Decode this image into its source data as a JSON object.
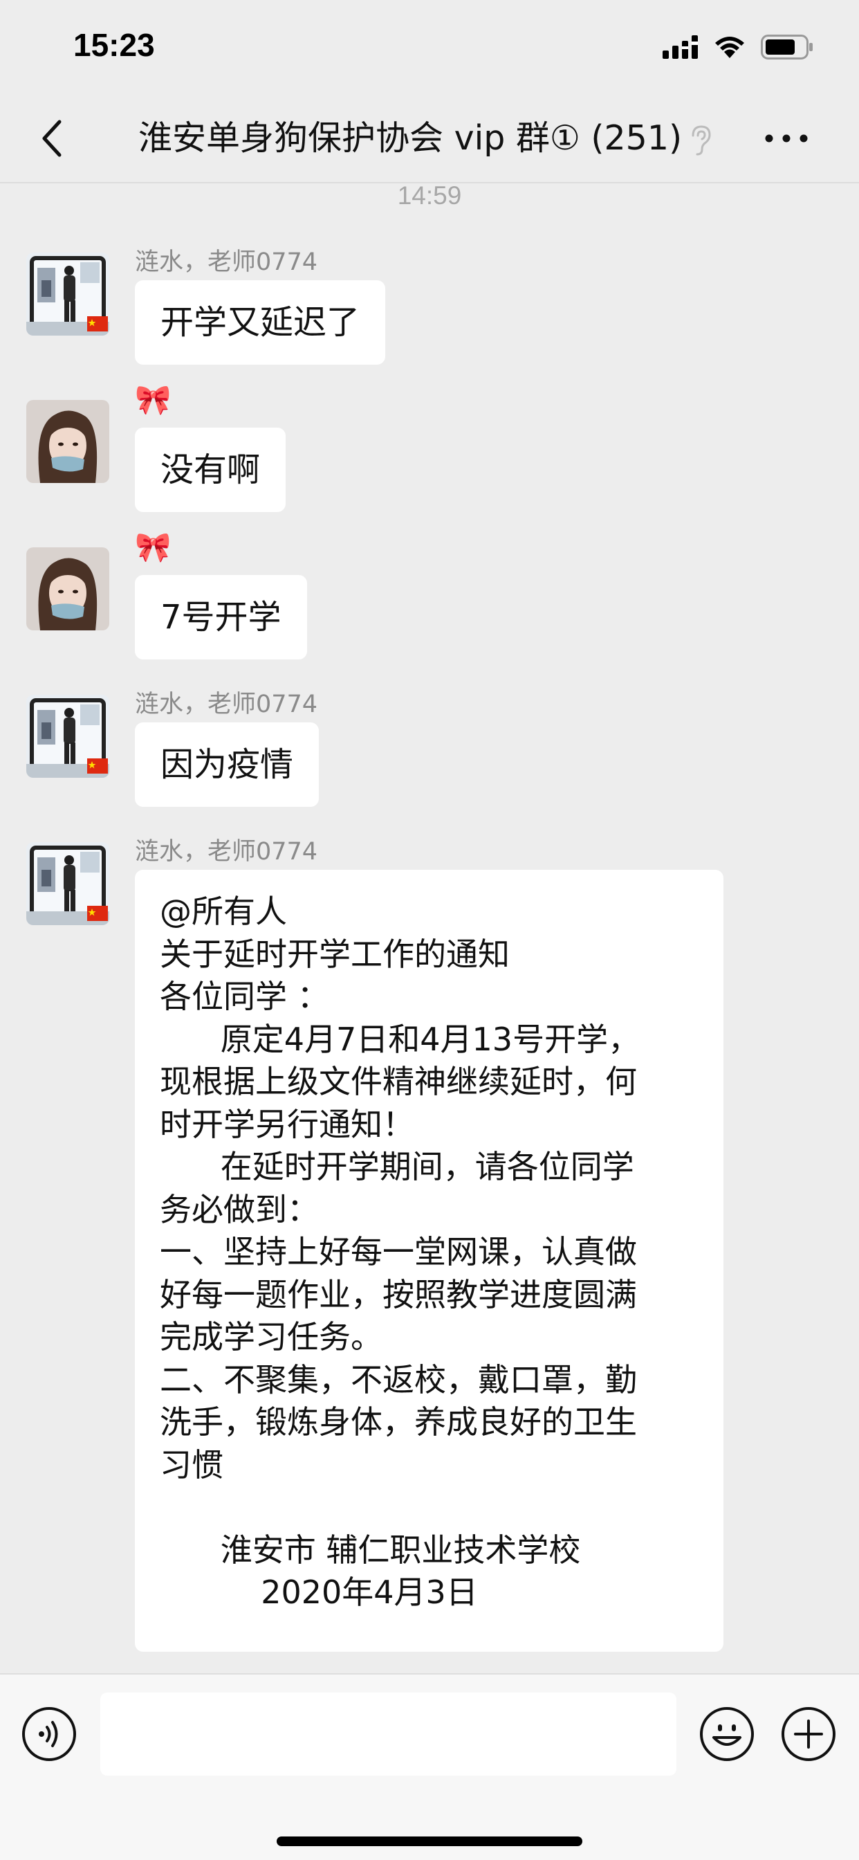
{
  "status_bar": {
    "time": "15:23",
    "signal_icon": "signal-bars-icon",
    "wifi_icon": "wifi-icon",
    "battery_icon": "battery-icon"
  },
  "nav": {
    "title": "淮安单身狗保护协会 vip 群① (251)",
    "back_icon": "chevron-left-icon",
    "ear_icon": "ear-icon",
    "more_icon": "more-dots-icon"
  },
  "chat": {
    "timestamp": "14:59",
    "messages": [
      {
        "sender": "涟水，老师0774",
        "text": "开学又延迟了"
      },
      {
        "sender": "🎀",
        "text": "没有啊"
      },
      {
        "sender": "🎀",
        "text": "7号开学"
      },
      {
        "sender": "涟水，老师0774",
        "text": "因为疫情"
      },
      {
        "sender": "涟水，老师0774",
        "lines": [
          "@所有人",
          "关于延时开学工作的通知",
          "各位同学 ：",
          "      原定4月7日和4月13号开学，",
          "现根据上级文件精神继续延时，何",
          "时开学另行通知！",
          "      在延时开学期间，请各位同学",
          "务必做到：",
          "一、坚持上好每一堂网课，认真做",
          "好每一题作业，按照教学进度圆满",
          "完成学习任务。",
          "二、不聚集，不返校，戴口罩，勤",
          "洗手，锻炼身体，养成良好的卫生",
          "习惯",
          "",
          "      淮安市 辅仁职业技术学校",
          "          2020年4月3日"
        ]
      }
    ]
  },
  "input_bar": {
    "voice_icon": "voice-icon",
    "emoji_icon": "emoji-icon",
    "plus_icon": "plus-icon",
    "text_value": ""
  },
  "colors": {
    "background": "#ededed",
    "bubble": "#ffffff",
    "meta_text": "#8a8a8a"
  }
}
